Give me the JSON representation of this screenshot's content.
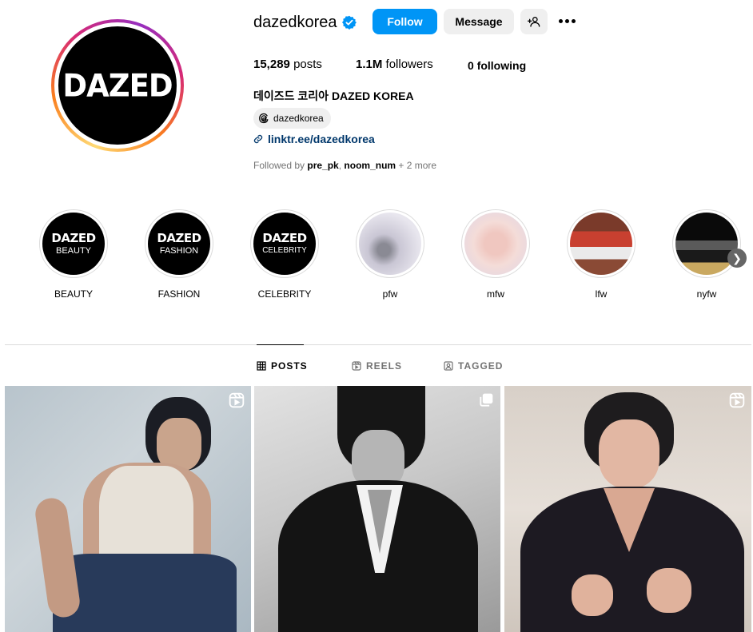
{
  "profile": {
    "username": "dazedkorea",
    "avatar_text": "DAZED",
    "buttons": {
      "follow": "Follow",
      "message": "Message"
    },
    "stats": {
      "posts_count": "15,289",
      "posts_label": "posts",
      "followers_count": "1.1M",
      "followers_label": "followers",
      "following_count": "0",
      "following_label": "following"
    },
    "full_name": "데이즈드 코리아 DAZED KOREA",
    "threads_handle": "dazedkorea",
    "link": "linktr.ee/dazedkorea",
    "followed_by": {
      "prefix": "Followed by ",
      "user1": "pre_pk",
      "sep": ", ",
      "user2": "noom_num",
      "suffix": " + 2 more"
    }
  },
  "highlights": [
    {
      "label": "BEAUTY",
      "logo": "DAZED",
      "sub": "BEAUTY"
    },
    {
      "label": "FASHION",
      "logo": "DAZED",
      "sub": "FASHION"
    },
    {
      "label": "CELEBRITY",
      "logo": "DAZED",
      "sub": "CELEBRITY"
    },
    {
      "label": "pfw"
    },
    {
      "label": "mfw"
    },
    {
      "label": "lfw"
    },
    {
      "label": "nyfw"
    }
  ],
  "tabs": {
    "posts": "POSTS",
    "reels": "REELS",
    "tagged": "TAGGED"
  },
  "colors": {
    "accent": "#0095f6",
    "verified": "#0095f6",
    "link": "#00376b"
  }
}
